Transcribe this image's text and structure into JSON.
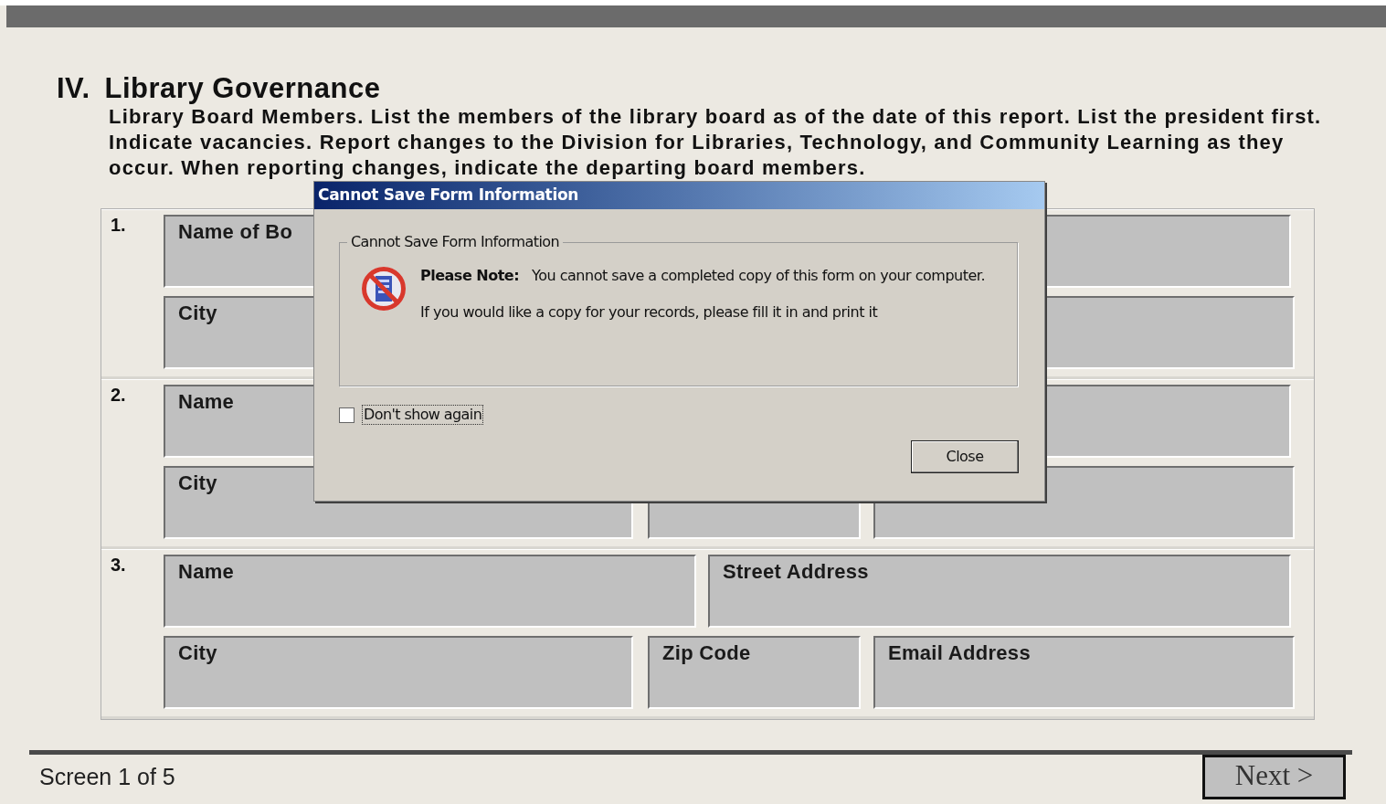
{
  "section": {
    "numeral": "IV.",
    "title": "Library Governance"
  },
  "instructions": "Library Board Members. List the members of the library board as of the date of this report. List the president first. Indicate vacancies. Report changes to the Division for Libraries, Technology, and Community Learning as they occur. When reporting changes, indicate the departing board members.",
  "board_members": [
    {
      "number": "1.",
      "fields": [
        {
          "kind": "input",
          "label": "Name of Bo"
        },
        {
          "kind": "input"
        },
        {
          "kind": "input",
          "label": "City"
        },
        {
          "kind": "covered"
        },
        {
          "kind": "input"
        }
      ]
    },
    {
      "number": "2.",
      "fields": [
        {
          "kind": "input",
          "label": "Name"
        },
        {
          "kind": "input"
        },
        {
          "kind": "input",
          "label": "City"
        },
        {
          "kind": "input"
        },
        {
          "kind": "input"
        }
      ]
    },
    {
      "number": "3.",
      "fields": [
        {
          "kind": "input",
          "label": "Name"
        },
        {
          "kind": "input",
          "label": "Street Address"
        },
        {
          "kind": "input",
          "label": "City"
        },
        {
          "kind": "input",
          "label": "Zip Code"
        },
        {
          "kind": "input",
          "label": "Email Address"
        }
      ]
    }
  ],
  "dialog": {
    "title": "Cannot Save Form Information",
    "group_label": "Cannot Save Form Information",
    "note_label": "Please Note:",
    "message": "You cannot save a completed copy of this form on your computer.",
    "message_2": "If you would like a copy for your records, please fill it in and print it",
    "dont_show_again": {
      "label": "Don't show again",
      "checked": false
    },
    "close_button": "Close"
  },
  "footer": {
    "screen_indicator": "Screen 1 of 5",
    "next_button": "Next >"
  }
}
